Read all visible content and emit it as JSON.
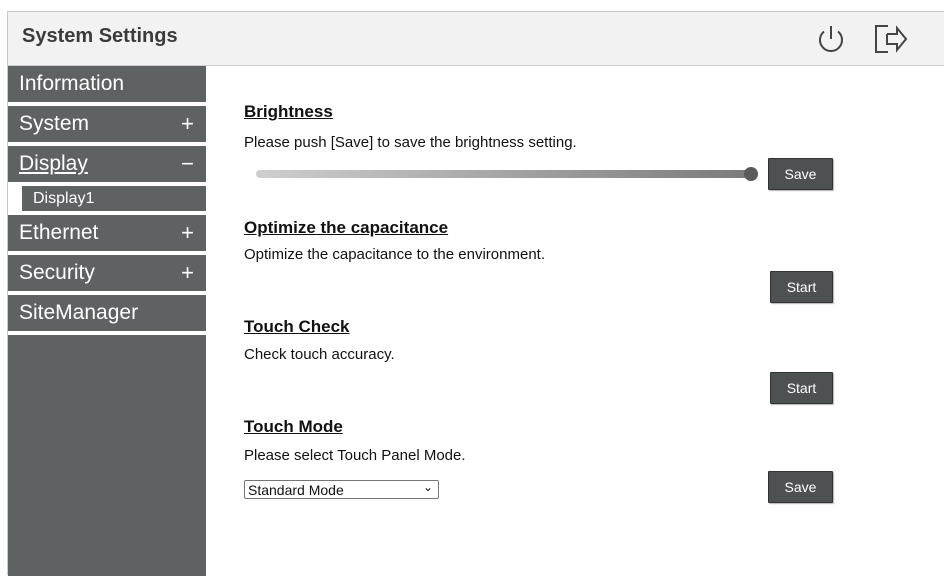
{
  "header": {
    "title": "System Settings",
    "power_icon": "power-icon",
    "logout_icon": "logout-icon"
  },
  "sidebar": {
    "items": [
      {
        "label": "Information",
        "toggle": ""
      },
      {
        "label": "System",
        "toggle": "+"
      },
      {
        "label": "Display",
        "toggle": "−",
        "active": true
      },
      {
        "label": "Ethernet",
        "toggle": "+"
      },
      {
        "label": "Security",
        "toggle": "+"
      },
      {
        "label": "SiteManager",
        "toggle": ""
      }
    ],
    "sub_item": "Display1"
  },
  "brightness": {
    "title": "Brightness",
    "desc": "Please push [Save] to save the brightness setting.",
    "level": 1.0,
    "button": "Save"
  },
  "capacitance": {
    "title": "Optimize the capacitance",
    "desc": "Optimize the capacitance to the environment.",
    "button": "Start"
  },
  "touch_check": {
    "title": "Touch Check",
    "desc": "Check touch accuracy.",
    "button": "Start"
  },
  "touch_mode": {
    "title": "Touch Mode",
    "desc": "Please select Touch Panel Mode.",
    "selected": "Standard Mode",
    "button": "Save"
  },
  "colors": {
    "sidebar": "#5e6262",
    "button": "#4d5151",
    "header": "#f2f2f2"
  }
}
